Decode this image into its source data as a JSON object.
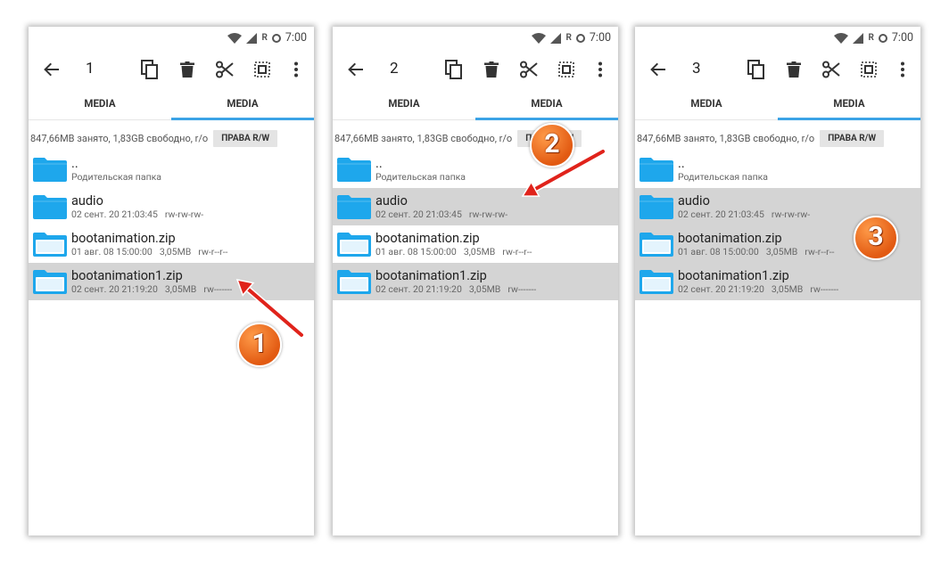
{
  "panels": [
    {
      "status": {
        "time": "7:00",
        "r": "R"
      },
      "selection_count": "1",
      "tabs": [
        "MEDIA",
        "MEDIA"
      ],
      "info": {
        "text": "847,66MB занято, 1,83GB свободно, r/o",
        "button": "ПРАВА R/W"
      },
      "rows": [
        {
          "name": "..",
          "meta": [
            "Родительская папка"
          ],
          "icon": "folder-icon",
          "selected": false
        },
        {
          "name": "audio",
          "meta": [
            "02 сент. 20 21:03:45",
            "rw-rw-rw-"
          ],
          "icon": "folder-icon",
          "selected": false
        },
        {
          "name": "bootanimation.zip",
          "meta": [
            "01 авг. 08 15:00:00",
            "3,05MB",
            "rw-r--r--"
          ],
          "icon": "zip-folder-icon",
          "selected": false
        },
        {
          "name": "bootanimation1.zip",
          "meta": [
            "02 сент. 20 21:19:20",
            "3,05MB",
            "rw-------"
          ],
          "icon": "zip-folder-icon",
          "selected": true
        }
      ],
      "step_badge": "1"
    },
    {
      "status": {
        "time": "7:00",
        "r": "R"
      },
      "selection_count": "2",
      "tabs": [
        "MEDIA",
        "MEDIA"
      ],
      "info": {
        "text": "847,66MB занято, 1,83GB свободно, r/o",
        "button": "ПРАВА R/W"
      },
      "rows": [
        {
          "name": "..",
          "meta": [
            "Родительская папка"
          ],
          "icon": "folder-icon",
          "selected": false
        },
        {
          "name": "audio",
          "meta": [
            "02 сент. 20 21:03:45",
            "rw-rw-rw-"
          ],
          "icon": "folder-icon",
          "selected": true
        },
        {
          "name": "bootanimation.zip",
          "meta": [
            "01 авг. 08 15:00:00",
            "3,05MB",
            "rw-r--r--"
          ],
          "icon": "zip-folder-icon",
          "selected": false
        },
        {
          "name": "bootanimation1.zip",
          "meta": [
            "02 сент. 20 21:19:20",
            "3,05MB",
            "rw-------"
          ],
          "icon": "zip-folder-icon",
          "selected": true
        }
      ],
      "step_badge": "2"
    },
    {
      "status": {
        "time": "7:00",
        "r": "R"
      },
      "selection_count": "3",
      "tabs": [
        "MEDIA",
        "MEDIA"
      ],
      "info": {
        "text": "847,66MB занято, 1,83GB свободно, r/o",
        "button": "ПРАВА R/W"
      },
      "rows": [
        {
          "name": "..",
          "meta": [
            "Родительская папка"
          ],
          "icon": "folder-icon",
          "selected": false
        },
        {
          "name": "audio",
          "meta": [
            "02 сент. 20 21:03:45",
            "rw-rw-rw-"
          ],
          "icon": "folder-icon",
          "selected": true
        },
        {
          "name": "bootanimation.zip",
          "meta": [
            "01 авг. 08 15:00:00",
            "3,05MB",
            "rw-r--r--"
          ],
          "icon": "zip-folder-icon",
          "selected": true
        },
        {
          "name": "bootanimation1.zip",
          "meta": [
            "02 сент. 20 21:19:20",
            "3,05MB",
            "rw-------"
          ],
          "icon": "zip-folder-icon",
          "selected": true
        }
      ],
      "step_badge": "3"
    }
  ],
  "colors": {
    "folder": "#1ea7ec",
    "accent": "#3ba3e6",
    "selected_row": "#d4d4d4",
    "badge": "#e25a12",
    "arrow": "#e0231b"
  },
  "toolbar_icons": [
    "back-arrow-icon",
    "copy-icon",
    "delete-icon",
    "cut-icon",
    "select-all-icon",
    "more-vert-icon"
  ]
}
